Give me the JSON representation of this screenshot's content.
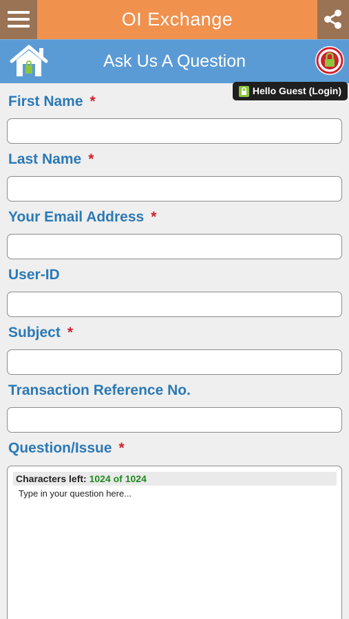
{
  "app": {
    "title": "OI Exchange",
    "subtitle": "Ask Us A Question",
    "guest_badge": "Hello Guest (Login)"
  },
  "form": {
    "fields": [
      {
        "label": "First Name",
        "required": true,
        "value": ""
      },
      {
        "label": "Last Name",
        "required": true,
        "value": ""
      },
      {
        "label": "Your Email Address",
        "required": true,
        "value": ""
      },
      {
        "label": "User-ID",
        "required": false,
        "value": ""
      },
      {
        "label": "Subject",
        "required": true,
        "value": ""
      },
      {
        "label": "Transaction Reference No.",
        "required": false,
        "value": ""
      }
    ],
    "question": {
      "label": "Question/Issue",
      "required": true,
      "counter_prefix": "Characters left:",
      "counter_value": "1024 of 1024",
      "placeholder": "Type in your question here..."
    },
    "required_marker": "*"
  },
  "colors": {
    "appbar": "#f0914e",
    "appbar_buttons": "#9a7354",
    "subbar": "#5b9bd5",
    "label": "#2b79b6",
    "required": "#d0202c",
    "counter_value": "#1d8a1d"
  },
  "icons": {
    "menu": "hamburger-menu-icon",
    "share": "share-icon",
    "home": "home-icon",
    "lock": "lock-icon"
  }
}
